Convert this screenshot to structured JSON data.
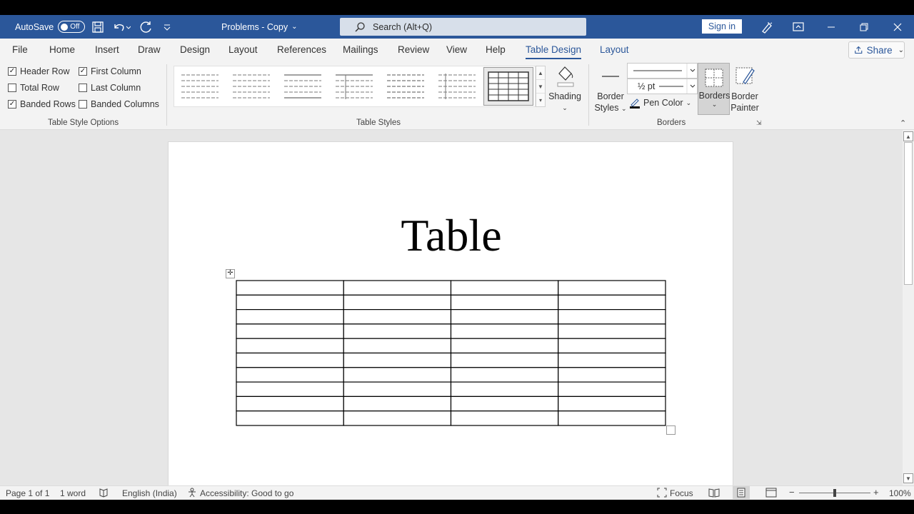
{
  "titlebar": {
    "autosave_label": "AutoSave",
    "autosave_state": "Off",
    "doc_title": "Problems - Copy",
    "search_placeholder": "Search (Alt+Q)",
    "signin_label": "Sign in"
  },
  "tabs": [
    "File",
    "Home",
    "Insert",
    "Draw",
    "Design",
    "Layout",
    "References",
    "Mailings",
    "Review",
    "View",
    "Help",
    "Table Design",
    "Layout"
  ],
  "active_tab": "Table Design",
  "share_label": "Share",
  "style_options": {
    "group_label": "Table Style Options",
    "items": [
      {
        "label": "Header Row",
        "checked": true
      },
      {
        "label": "First Column",
        "checked": true
      },
      {
        "label": "Total Row",
        "checked": false
      },
      {
        "label": "Last Column",
        "checked": false
      },
      {
        "label": "Banded Rows",
        "checked": true
      },
      {
        "label": "Banded Columns",
        "checked": false
      }
    ]
  },
  "table_styles": {
    "group_label": "Table Styles",
    "shading_label": "Shading"
  },
  "borders_group": {
    "group_label": "Borders",
    "border_styles_line1": "Border",
    "border_styles_line2": "Styles",
    "pen_weight": "½ pt",
    "pen_color_label": "Pen Color",
    "borders_label": "Borders",
    "border_painter_line1": "Border",
    "border_painter_line2": "Painter"
  },
  "document": {
    "title": "Table",
    "table_rows": 10,
    "table_cols": 4
  },
  "status": {
    "page": "Page 1 of 1",
    "words": "1 word",
    "language": "English (India)",
    "accessibility": "Accessibility: Good to go",
    "focus": "Focus",
    "zoom": "100%",
    "zoom_level": 0.5
  },
  "colors": {
    "accent": "#2b579a",
    "ribbon_bg": "#f3f3f3"
  }
}
